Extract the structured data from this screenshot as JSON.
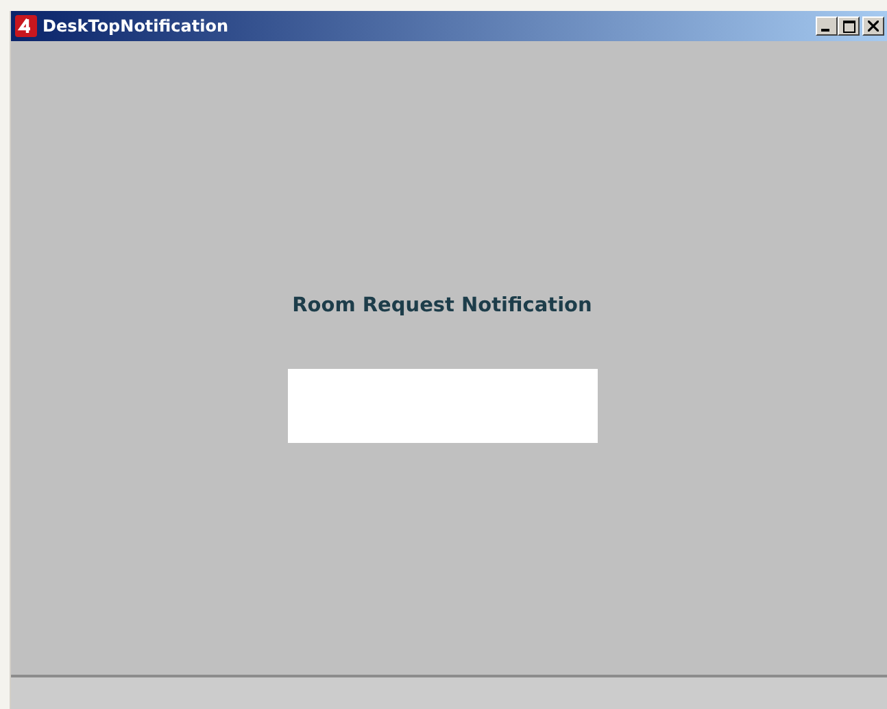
{
  "window": {
    "title": "DeskTopNotification"
  },
  "heading": "Room Request Notification"
}
